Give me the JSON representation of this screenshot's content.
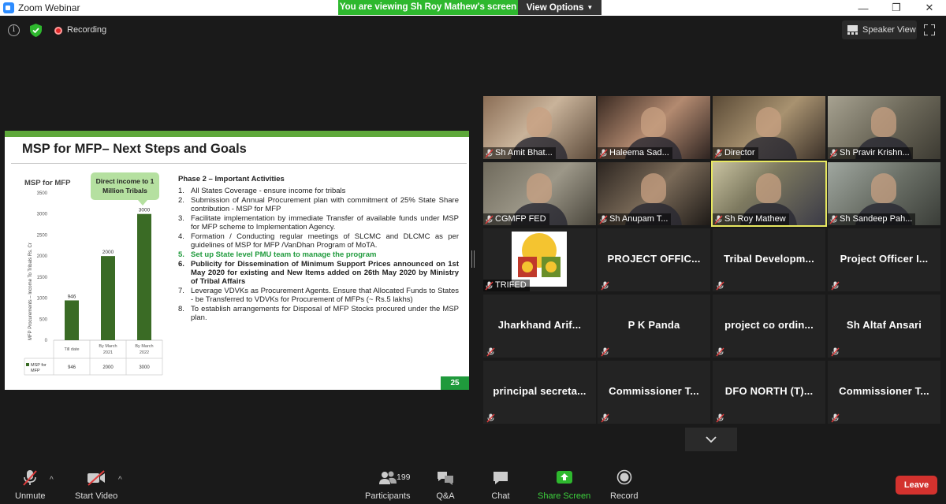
{
  "window": {
    "title": "Zoom Webinar",
    "viewing_banner": "You are viewing Sh Roy Mathew's screen",
    "view_options": "View Options"
  },
  "infobar": {
    "recording_label": "Recording",
    "speaker_view_label": "Speaker View"
  },
  "slide": {
    "title": "MSP for MFP– Next Steps and Goals",
    "callout": "Direct income to 1 Million Tribals",
    "phase_heading": "Phase 2 – Important Activities",
    "page_number": "25",
    "bullets": [
      {
        "num": "1.",
        "text": "All States Coverage -  ensure income for tribals",
        "style": "n"
      },
      {
        "num": "2.",
        "text": "Submission of Annual Procurement plan with commitment of 25% State Share contribution - MSP for MFP",
        "style": "n"
      },
      {
        "num": "3.",
        "text": "Facilitate implementation by immediate Transfer of available funds under MSP for MFP scheme to Implementation Agency.",
        "style": "n"
      },
      {
        "num": "4.",
        "text": "Formation / Conducting regular meetings of SLCMC and DLCMC as per guidelines of MSP for MFP /VanDhan Program of MoTA.",
        "style": "n"
      },
      {
        "num": "5.",
        "text": "Set up State level PMU team to manage the program",
        "style": "g"
      },
      {
        "num": "6.",
        "text": "Publicity for Dissemination of Minimum Support Prices announced on 1st May 2020 for existing and New Items added on 26th May 2020  by Ministry of Tribal Affairs",
        "style": "b"
      },
      {
        "num": "7.",
        "text": "Leverage VDVKs as Procurement Agents. Ensure that Allocated Funds to States - be Transferred to VDVKs for Procurement of MFPs (~ Rs.5 lakhs)",
        "style": "n"
      },
      {
        "num": "8.",
        "text": "To establish arrangements for Disposal of MFP Stocks procured under the MSP plan.",
        "style": "n"
      }
    ]
  },
  "chart_data": {
    "type": "bar",
    "title": "MSP for MFP",
    "ylabel": "MFP Procurements – Income To Tribals Rs. Cr",
    "xlabel": "",
    "categories": [
      "Till date",
      "By March 2021",
      "By March 2022"
    ],
    "series": [
      {
        "name": "MSP for MFP",
        "values": [
          946,
          2000,
          3000
        ]
      }
    ],
    "ylim": [
      0,
      3500
    ],
    "yticks": [
      0,
      500,
      1000,
      1500,
      2000,
      2500,
      3000,
      3500
    ],
    "data_labels": [
      "946",
      "2000",
      "3000"
    ],
    "legend": "table-below",
    "color": "#3a6b25"
  },
  "participants": [
    {
      "name": "Sh Amit Bhat...",
      "kind": "video"
    },
    {
      "name": "Haleema Sad...",
      "kind": "video"
    },
    {
      "name": "Director",
      "kind": "video"
    },
    {
      "name": "Sh Pravir Krishn...",
      "kind": "video"
    },
    {
      "name": "CGMFP FED",
      "kind": "video"
    },
    {
      "name": "Sh Anupam T...",
      "kind": "video"
    },
    {
      "name": "Sh Roy Mathew",
      "kind": "video",
      "active": true
    },
    {
      "name": "Sh Sandeep Pah...",
      "kind": "video"
    },
    {
      "name": "TRIFED",
      "kind": "logo"
    },
    {
      "name": "PROJECT OFFIC...",
      "kind": "name"
    },
    {
      "name": "Tribal  Developm...",
      "kind": "name"
    },
    {
      "name": "Project Officer I...",
      "kind": "name"
    },
    {
      "name": "Jharkhand  Arif...",
      "kind": "name"
    },
    {
      "name": "P K Panda",
      "kind": "name"
    },
    {
      "name": "project co ordin...",
      "kind": "name"
    },
    {
      "name": "Sh Altaf Ansari",
      "kind": "name"
    },
    {
      "name": "principal  secreta...",
      "kind": "name"
    },
    {
      "name": "Commissioner  T...",
      "kind": "name"
    },
    {
      "name": "DFO NORTH (T)...",
      "kind": "name"
    },
    {
      "name": "Commissioner  T...",
      "kind": "name"
    }
  ],
  "toolbar": {
    "unmute": "Unmute",
    "start_video": "Start Video",
    "participants": "Participants",
    "participants_count": "199",
    "qa": "Q&A",
    "chat": "Chat",
    "share_screen": "Share Screen",
    "record": "Record",
    "leave": "Leave"
  },
  "colors": {
    "share_green": "#2eb82e",
    "leave_red": "#d3322e",
    "active_speaker": "#e8e860",
    "slide_green": "#1f9a3c"
  }
}
